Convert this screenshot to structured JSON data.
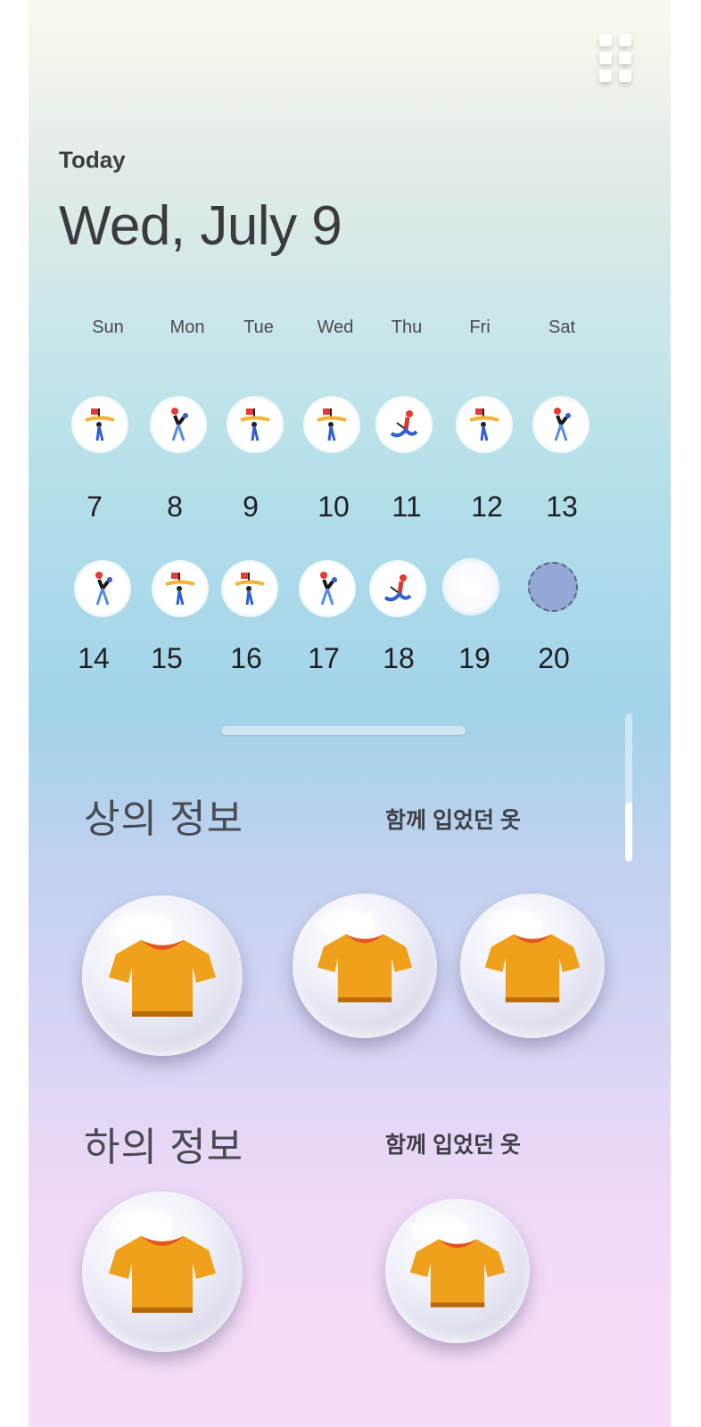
{
  "header": {
    "today_label": "Today",
    "date_title": "Wed, July 9",
    "menu_icon": "grid-menu-icon"
  },
  "calendar": {
    "weekdays": [
      "Sun",
      "Mon",
      "Tue",
      "Wed",
      "Thu",
      "Fri",
      "Sat"
    ],
    "week1": {
      "days": [
        "7",
        "8",
        "9",
        "10",
        "11",
        "12",
        "13"
      ],
      "icons": [
        "flag-runner-icon",
        "walker-icon",
        "flag-runner-icon",
        "flag-runner-icon",
        "sitting-figure-icon",
        "flag-runner-icon",
        "walker-icon"
      ]
    },
    "week2": {
      "days": [
        "14",
        "15",
        "16",
        "17",
        "18",
        "19",
        "20"
      ],
      "icons": [
        "walker-icon",
        "flag-runner-icon",
        "flag-runner-icon",
        "walker-icon",
        "sitting-figure-icon",
        "empty",
        "selected-dashed-circle"
      ]
    },
    "selected_day": "20"
  },
  "tops": {
    "title": "상의 정보",
    "link": "함께 입었던 옷",
    "items": [
      "t-shirt-icon",
      "t-shirt-icon",
      "t-shirt-icon"
    ]
  },
  "bottoms": {
    "title": "하의 정보",
    "link": "함께 입었던 옷",
    "items": [
      "t-shirt-icon",
      "t-shirt-icon"
    ]
  },
  "colors": {
    "shirt_body": "#f0a11c",
    "shirt_collar": "#e2551d",
    "selected_circle": "#93a8d6"
  }
}
